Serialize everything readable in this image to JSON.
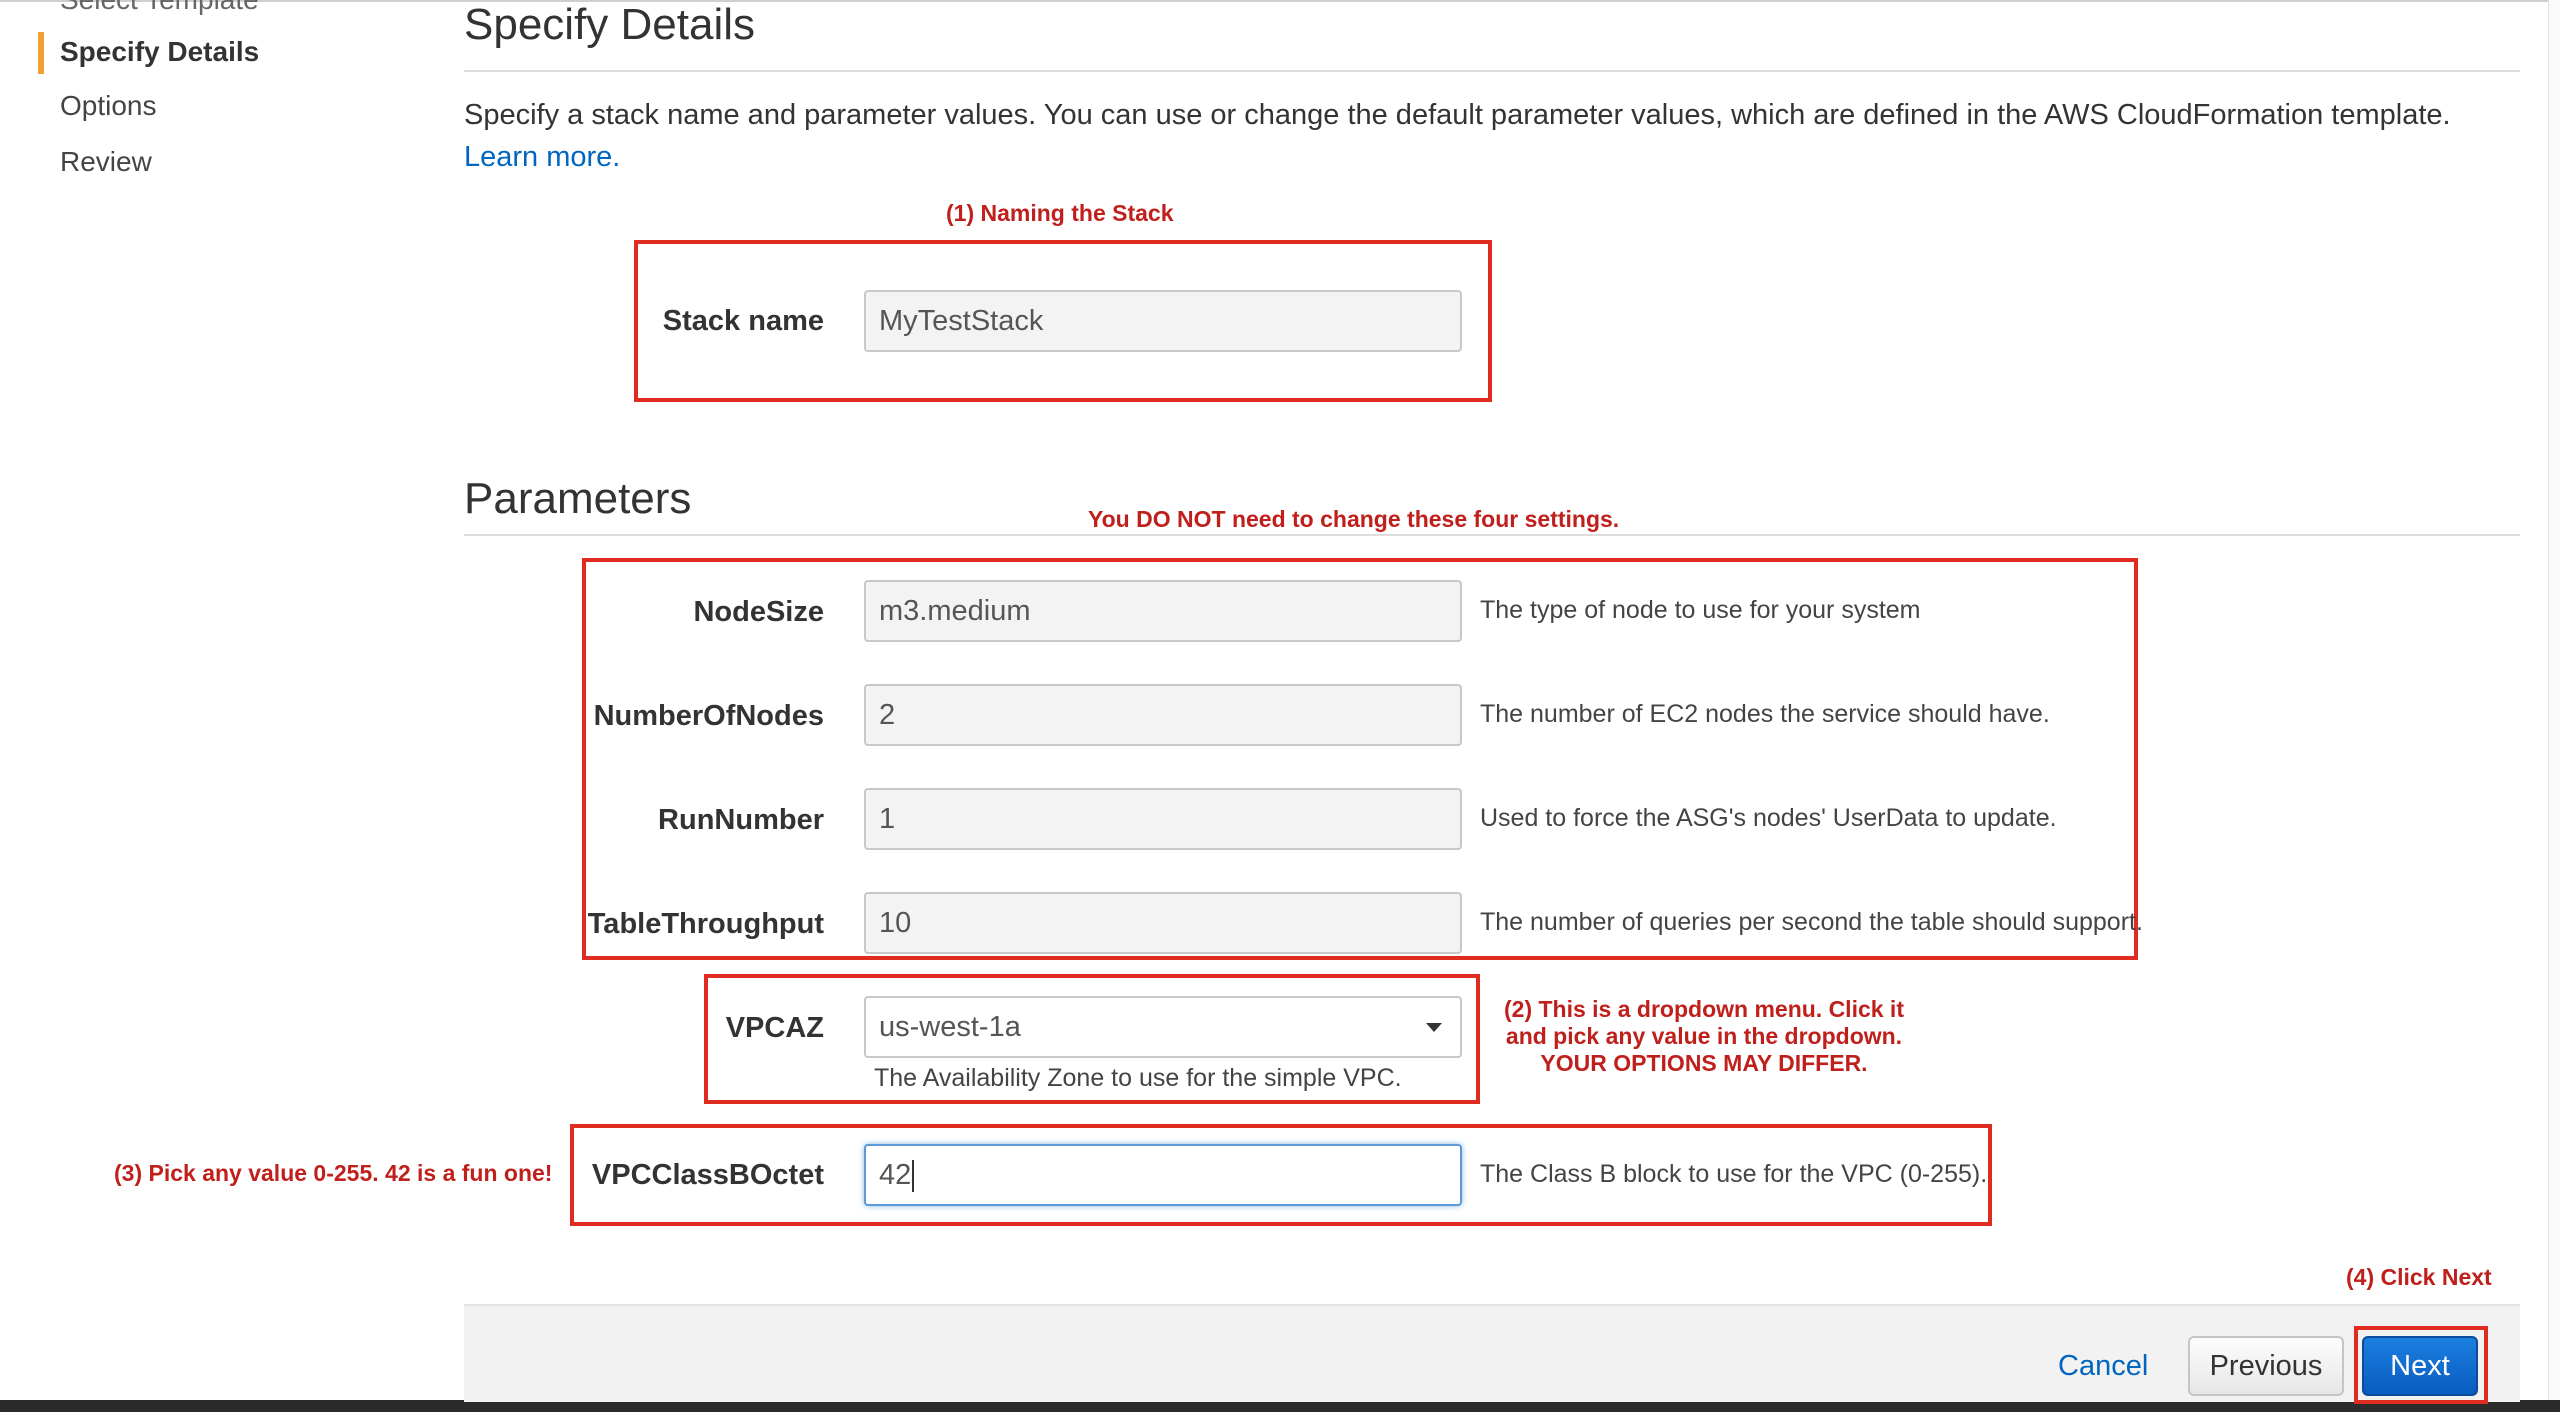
{
  "sidebar": {
    "items": [
      {
        "label": "Select Template",
        "state": "cut-off"
      },
      {
        "label": "Specify Details",
        "state": "active"
      },
      {
        "label": "Options",
        "state": "normal"
      },
      {
        "label": "Review",
        "state": "normal"
      }
    ]
  },
  "details": {
    "heading": "Specify Details",
    "intro_text": "Specify a stack name and parameter values. You can use or change the default parameter values, which are defined in the AWS CloudFormation template.",
    "learn_more": "Learn more.",
    "stack_name_label": "Stack name",
    "stack_name_value": "MyTestStack"
  },
  "parameters": {
    "heading": "Parameters",
    "node_size": {
      "label": "NodeSize",
      "value": "m3.medium",
      "desc": "The type of node to use for your system"
    },
    "number_of_nodes": {
      "label": "NumberOfNodes",
      "value": "2",
      "desc": "The number of EC2 nodes the service should have."
    },
    "run_number": {
      "label": "RunNumber",
      "value": "1",
      "desc": "Used to force the ASG's nodes' UserData to update."
    },
    "table_throughput": {
      "label": "TableThroughput",
      "value": "10",
      "desc": "The number of queries per second the table should support."
    },
    "vpcaz": {
      "label": "VPCAZ",
      "value": "us-west-1a",
      "desc": "The Availability Zone to use for the simple VPC."
    },
    "vpc_class_b_octet": {
      "label": "VPCClassBOctet",
      "value": "42",
      "desc": "The Class B block to use for the VPC (0-255)."
    }
  },
  "annotations": {
    "naming": "(1) Naming the Stack",
    "no_change": "You DO NOT need to change these four settings.",
    "dropdown_line1": "(2) This is a dropdown menu. Click it",
    "dropdown_line2": "and pick any value in the dropdown.",
    "dropdown_line3": "YOUR OPTIONS MAY DIFFER.",
    "octet": "(3) Pick any value 0-255. 42 is a fun one!",
    "click_next": "(4) Click Next"
  },
  "footer": {
    "cancel": "Cancel",
    "previous": "Previous",
    "next": "Next"
  },
  "colors": {
    "annotation_red": "#c0201c",
    "box_red": "#e02b20",
    "link_blue": "#0066c0",
    "next_blue": "#0a5cc0",
    "active_nav_accent": "#f0a030"
  }
}
